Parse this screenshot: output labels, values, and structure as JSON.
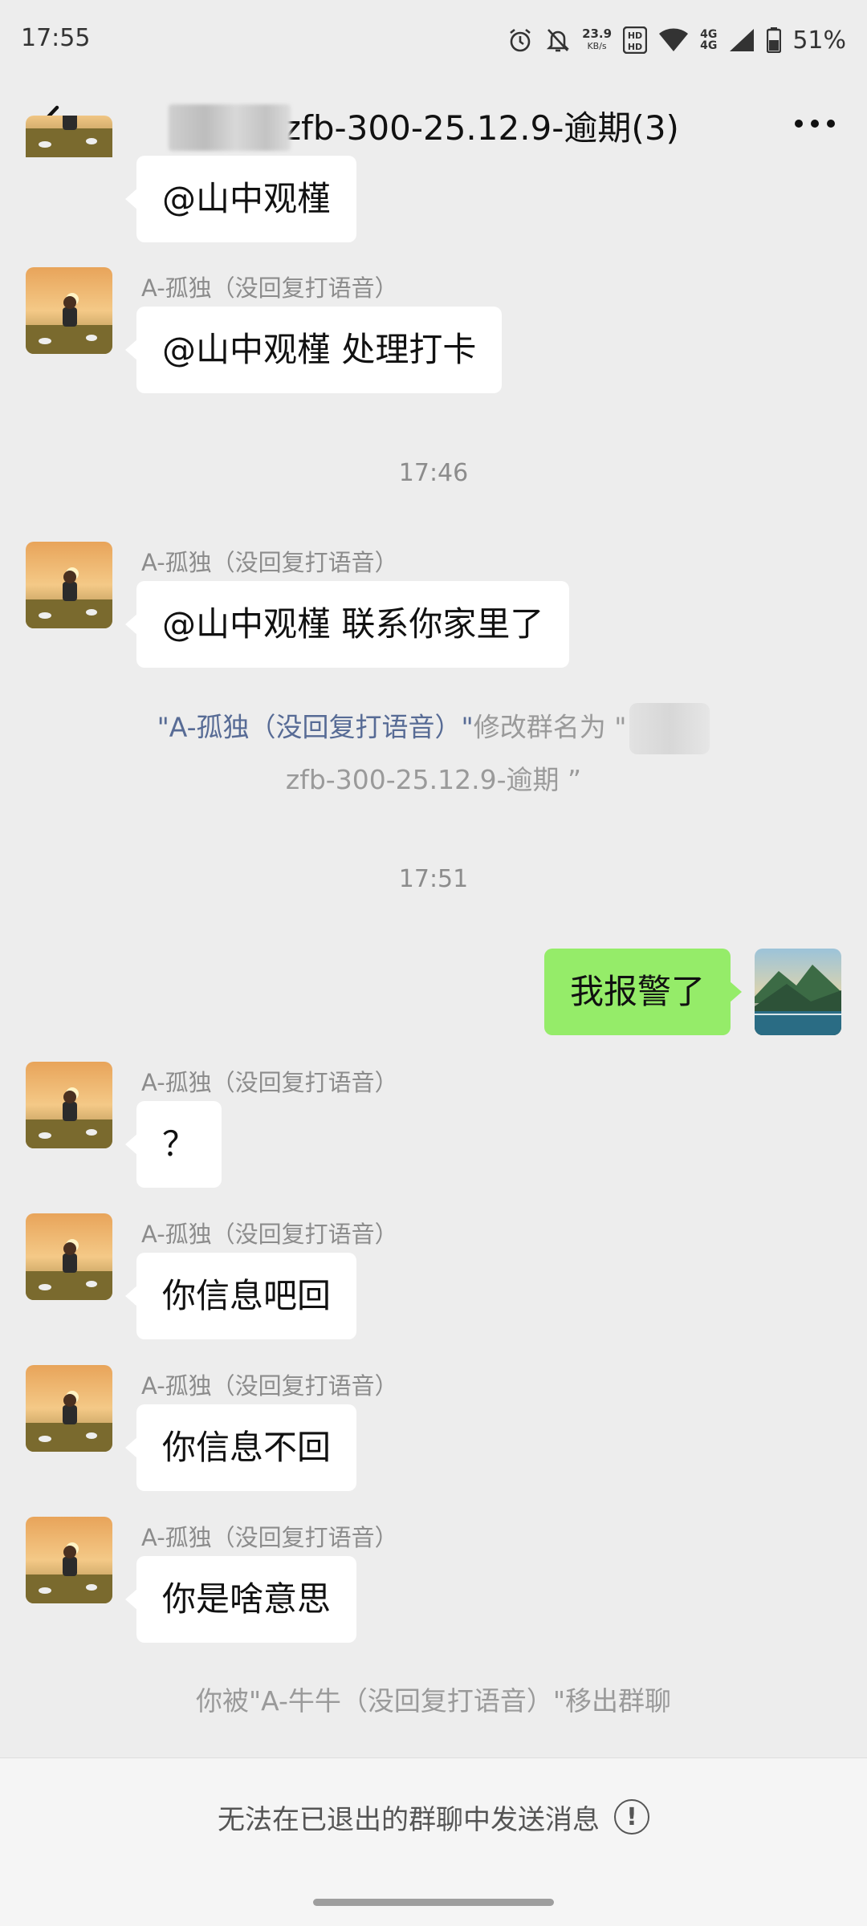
{
  "status_bar": {
    "time": "17:55",
    "net_speed_value": "23.9",
    "net_speed_unit": "KB/s",
    "net_type_top": "4G",
    "net_type_bottom": "4G",
    "battery": "51%"
  },
  "nav": {
    "title": "zfb-300-25.12.9-逾期(3)",
    "back_icon": "chevron-left-icon",
    "more_icon": "more-icon"
  },
  "messages": [
    {
      "type": "received",
      "sender": "",
      "text": "@山中观槿"
    },
    {
      "type": "received",
      "sender": "A-孤独（没回复打语音）",
      "text": "@山中观槿  处理打卡"
    },
    {
      "type": "time",
      "text": "17:46"
    },
    {
      "type": "received",
      "sender": "A-孤独（没回复打语音）",
      "text": "@山中观槿  联系你家里了"
    },
    {
      "type": "system",
      "actor": "\"A-孤独（没回复打语音）\"",
      "action": "修改群名为 \"",
      "new_name": "zfb-300-25.12.9-逾期 ”"
    },
    {
      "type": "time",
      "text": "17:51"
    },
    {
      "type": "sent",
      "text": "我报警了"
    },
    {
      "type": "received",
      "sender": "A-孤独（没回复打语音）",
      "text": "？"
    },
    {
      "type": "received",
      "sender": "A-孤独（没回复打语音）",
      "text": "你信息吧回"
    },
    {
      "type": "received",
      "sender": "A-孤独（没回复打语音）",
      "text": "你信息不回"
    },
    {
      "type": "received",
      "sender": "A-孤独（没回复打语音）",
      "text": "你是啥意思"
    },
    {
      "type": "system_plain",
      "text": "你被\"A-牛牛（没回复打语音）\"移出群聊"
    }
  ],
  "bottom": {
    "notice": "无法在已退出的群聊中发送消息",
    "icon": "info-icon",
    "icon_glyph": "!"
  },
  "colors": {
    "background": "#ededed",
    "self_bubble": "#95ec69",
    "other_bubble": "#ffffff",
    "link": "#576b95"
  }
}
